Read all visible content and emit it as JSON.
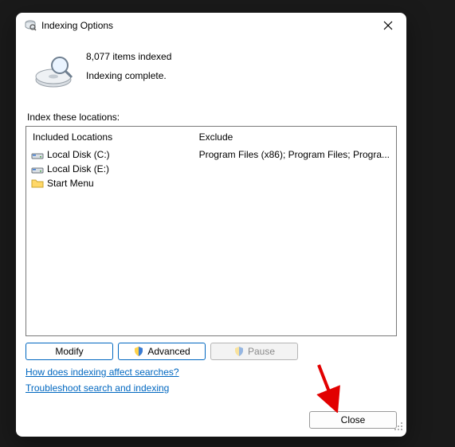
{
  "titlebar": {
    "title": "Indexing Options"
  },
  "status": {
    "items_indexed": "8,077 items indexed",
    "state": "Indexing complete."
  },
  "locations_label": "Index these locations:",
  "columns": {
    "included": "Included Locations",
    "exclude": "Exclude"
  },
  "rows": [
    {
      "label": "Local Disk (C:)",
      "exclude": "Program Files (x86); Program Files; Progra..."
    },
    {
      "label": "Local Disk (E:)",
      "exclude": ""
    },
    {
      "label": "Start Menu",
      "exclude": ""
    }
  ],
  "buttons": {
    "modify": "Modify",
    "advanced": "Advanced",
    "pause": "Pause",
    "close": "Close"
  },
  "links": {
    "how": "How does indexing affect searches?",
    "troubleshoot": "Troubleshoot search and indexing"
  }
}
